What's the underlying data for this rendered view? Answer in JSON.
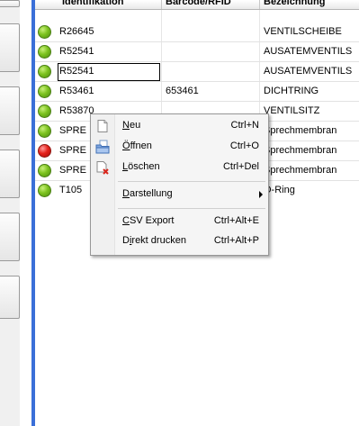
{
  "grid": {
    "headers": [
      "Identifikation",
      "Barcode/RFID",
      "Bezeichnung"
    ],
    "rows": [
      {
        "status": "green",
        "id": "R26645",
        "barcode": "",
        "bezeichnung": "VENTILSCHEIBE"
      },
      {
        "status": "green",
        "id": "R52541",
        "barcode": "",
        "bezeichnung": "AUSATEMVENTILS"
      },
      {
        "status": "green",
        "id": "R52541",
        "barcode": "",
        "bezeichnung": "AUSATEMVENTILS"
      },
      {
        "status": "green",
        "id": "R53461",
        "barcode": "653461",
        "bezeichnung": "DICHTRING"
      },
      {
        "status": "green",
        "id": "R53870",
        "barcode": "",
        "bezeichnung": "VENTILSITZ"
      },
      {
        "status": "red",
        "id": "SPRE",
        "barcode": "",
        "bezeichnung": "Sprechmembran"
      },
      {
        "status": "red",
        "id": "SPRE",
        "barcode": "",
        "bezeichnung": "Sprechmembran"
      },
      {
        "status": "green",
        "id": "SPRE",
        "barcode": "",
        "bezeichnung": "Sprechmembran"
      },
      {
        "status": "green",
        "id": "T105",
        "barcode": "",
        "bezeichnung": "O-Ring"
      }
    ]
  },
  "context_menu": {
    "items": {
      "neu": {
        "pre": "",
        "acc": "N",
        "post": "eu",
        "shortcut": "Ctrl+N",
        "icon": "new-document-icon"
      },
      "oeffnen": {
        "pre": "",
        "acc": "Ö",
        "post": "ffnen",
        "shortcut": "Ctrl+O",
        "icon": "open-folder-icon"
      },
      "loeschen": {
        "pre": "",
        "acc": "L",
        "post": "öschen",
        "shortcut": "Ctrl+Del",
        "icon": "delete-document-icon"
      },
      "darstellung": {
        "pre": "",
        "acc": "D",
        "post": "arstellung",
        "shortcut": ""
      },
      "csv": {
        "pre": "",
        "acc": "C",
        "post": "SV Export",
        "shortcut": "Ctrl+Alt+E"
      },
      "drucken": {
        "pre": "D",
        "acc": "i",
        "post": "rekt drucken",
        "shortcut": "Ctrl+Alt+P"
      }
    }
  },
  "colors": {
    "accent_bar": "#3a6fd8",
    "status_green": "#7dc31f",
    "status_red": "#e5231c"
  }
}
